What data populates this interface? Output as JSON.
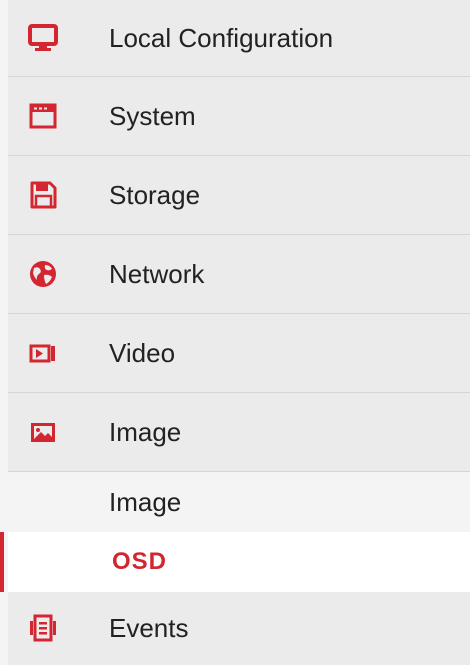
{
  "accent_color": "#d32630",
  "menu": [
    {
      "label": "Local Configuration",
      "icon": "monitor-icon"
    },
    {
      "label": "System",
      "icon": "system-window-icon"
    },
    {
      "label": "Storage",
      "icon": "floppy-disk-icon"
    },
    {
      "label": "Network",
      "icon": "globe-icon"
    },
    {
      "label": "Video",
      "icon": "video-camera-icon"
    },
    {
      "label": "Image",
      "icon": "picture-icon",
      "expanded": true
    }
  ],
  "image_submenu": [
    {
      "label": "Image",
      "active": false
    },
    {
      "label": "OSD",
      "active": true
    }
  ],
  "events": {
    "label": "Events",
    "icon": "events-list-icon"
  }
}
